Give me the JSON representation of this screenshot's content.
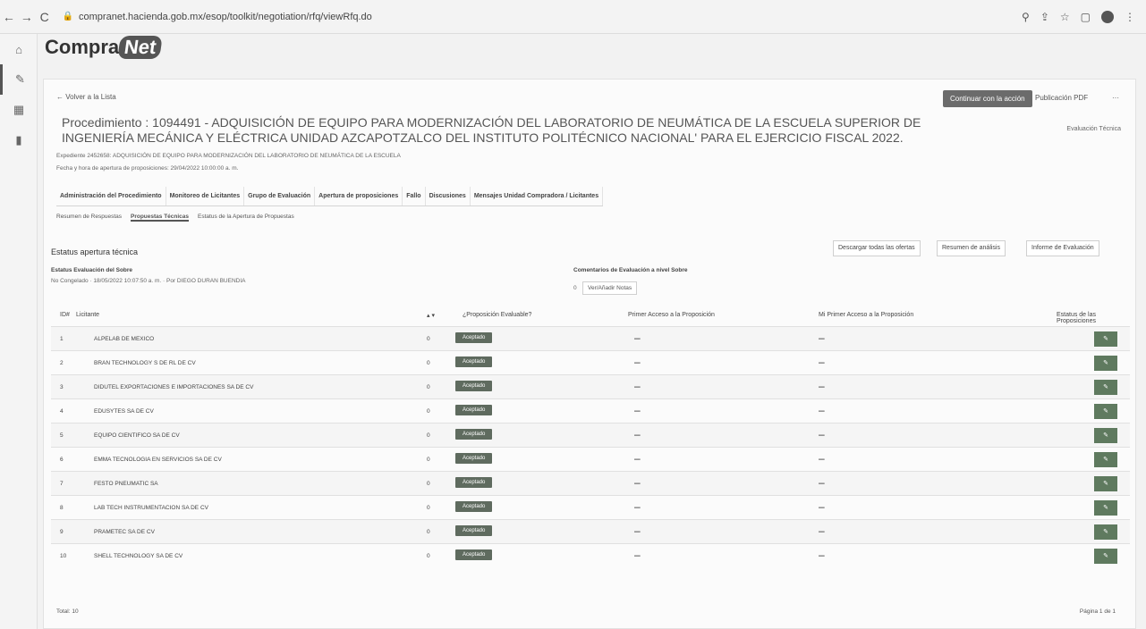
{
  "browser": {
    "url": "compranet.hacienda.gob.mx/esop/toolkit/negotiation/rfq/viewRfq.do",
    "nav_back": "←",
    "nav_forward": "→",
    "nav_reload": "C",
    "lock": "🔒",
    "icons": [
      "magnifier-icon",
      "share-icon",
      "star-icon",
      "window-icon",
      "profile-icon",
      "kebab-icon"
    ],
    "search_glyph": "⚲",
    "share_glyph": "⇪",
    "star_glyph": "☆",
    "window_glyph": "▢",
    "menu_glyph": "⋮"
  },
  "rail": {
    "home": "⌂",
    "active": "✎",
    "grid": "▦",
    "book": "▮"
  },
  "logo": {
    "part1": "Compra",
    "part2": "Net"
  },
  "header": {
    "back_label": "← Volver a la Lista",
    "continue_button": "Continuar con la acción",
    "pdf_label": "Publicación PDF",
    "more": "···",
    "title": "Procedimiento : 1094491 - ADQUISICIÓN DE EQUIPO PARA MODERNIZACIÓN DEL LABORATORIO DE NEUMÁTICA DE LA ESCUELA SUPERIOR DE INGENIERÍA MECÁNICA Y ELÉCTRICA UNIDAD AZCAPOTZALCO DEL INSTITUTO POLITÉCNICO NACIONAL' PARA EL EJERCICIO FISCAL 2022.",
    "expediente": "Expediente 2452658: ADQUISICIÓN DE EQUIPO PARA MODERNIZACIÓN DEL LABORATORIO DE NEUMÁTICA DE LA ESCUELA",
    "fecha": "Fecha y hora de apertura de proposiciones: 29/04/2022 10:00:00 a. m.",
    "eval_tecnica": "Evaluación Técnica"
  },
  "tabs": [
    "Administración del Procedimiento",
    "Monitoreo de Licitantes",
    "Grupo de Evaluación",
    "Apertura de proposiciones",
    "Fallo",
    "Discusiones",
    "Mensajes Unidad Compradora / Licitantes"
  ],
  "subtabs": [
    "Resumen de Respuestas",
    "Propuestas Técnicas",
    "Estatus de la Apertura de Propuestas"
  ],
  "section": {
    "title": "Estatus apertura técnica",
    "download_btn": "Descargar todas las ofertas",
    "summary_btn": "Resumen de análisis",
    "report_btn": "Informe de Evaluación",
    "estatus_label": "Estatus Evaluación del Sobre",
    "estatus_value": "No Congelado · 18/05/2022 10:07:50 a. m. · Por DIEGO DURAN BUENDIA",
    "comentarios_label": "Comentarios de Evaluación a nivel Sobre",
    "comentarios_count": "0",
    "notes_btn": "Ver/Añadir Notas"
  },
  "table": {
    "headers": {
      "num": "ID#",
      "licitante": "Licitante",
      "count": "▴ ▾",
      "solvente": "¿Proposición Evaluable?",
      "first": "Primer Acceso a la Proposición",
      "my_first": "Mi Primer Acceso a la Proposición",
      "estatus": "Estatus de las Proposiciones"
    },
    "rows": [
      {
        "num": "1",
        "name": "ALPELAB DE MEXICO",
        "count": "0",
        "status": "Aceptado",
        "first": "–",
        "my_first": "–",
        "action": "✎"
      },
      {
        "num": "2",
        "name": "BRAN TECHNOLOGY S DE RL DE CV",
        "count": "0",
        "status": "Aceptado",
        "first": "–",
        "my_first": "–",
        "action": "✎"
      },
      {
        "num": "3",
        "name": "DIDUTEL EXPORTACIONES E IMPORTACIONES SA DE CV",
        "count": "0",
        "status": "Aceptado",
        "first": "–",
        "my_first": "–",
        "action": "✎"
      },
      {
        "num": "4",
        "name": "EDUSYTES SA DE CV",
        "count": "0",
        "status": "Aceptado",
        "first": "–",
        "my_first": "–",
        "action": "✎"
      },
      {
        "num": "5",
        "name": "EQUIPO CIENTIFICO SA DE CV",
        "count": "0",
        "status": "Aceptado",
        "first": "–",
        "my_first": "–",
        "action": "✎"
      },
      {
        "num": "6",
        "name": "EMMA TECNOLOGIA EN SERVICIOS SA DE CV",
        "count": "0",
        "status": "Aceptado",
        "first": "–",
        "my_first": "–",
        "action": "✎"
      },
      {
        "num": "7",
        "name": "FESTO PNEUMATIC SA",
        "count": "0",
        "status": "Aceptado",
        "first": "–",
        "my_first": "–",
        "action": "✎"
      },
      {
        "num": "8",
        "name": "LAB TECH INSTRUMENTACION SA DE CV",
        "count": "0",
        "status": "Aceptado",
        "first": "–",
        "my_first": "–",
        "action": "✎"
      },
      {
        "num": "9",
        "name": "PRAMETEC SA DE CV",
        "count": "0",
        "status": "Aceptado",
        "first": "–",
        "my_first": "–",
        "action": "✎"
      },
      {
        "num": "10",
        "name": "SHELL TECHNOLOGY SA DE CV",
        "count": "0",
        "status": "Aceptado",
        "first": "–",
        "my_first": "–",
        "action": "✎"
      }
    ],
    "total": "Total: 10",
    "page": "Página 1 de 1"
  }
}
